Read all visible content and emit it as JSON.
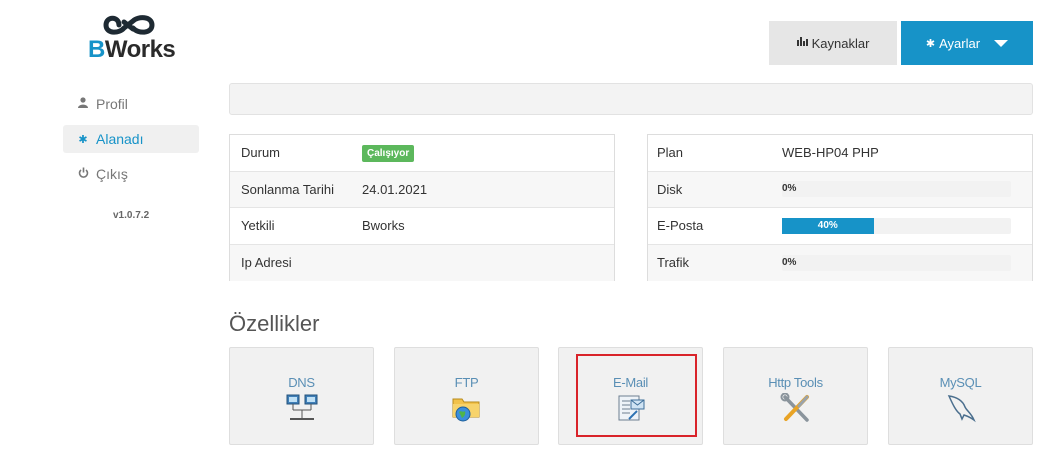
{
  "brand": {
    "name_prefix": "B",
    "name_rest": "Works",
    "accent": "#1793c8",
    "logo_icon": "infinity-logo"
  },
  "sidebar": {
    "items": [
      {
        "label": "Profil",
        "icon": "user-icon",
        "active": false
      },
      {
        "label": "Alanadı",
        "icon": "gear-icon",
        "active": true
      },
      {
        "label": "Çıkış",
        "icon": "power-icon",
        "active": false
      }
    ],
    "version": "v1.0.7.2"
  },
  "header": {
    "resources_label": "Kaynaklar",
    "resources_icon": "bar-chart-icon",
    "settings_label": "Ayarlar",
    "settings_icon": "gear-icon"
  },
  "info_left": [
    {
      "key": "Durum",
      "value": "Çalışıyor",
      "status_color": "#5cb85c"
    },
    {
      "key": "Sonlanma Tarihi",
      "value": "24.01.2021"
    },
    {
      "key": "Yetkili",
      "value": "Bworks"
    },
    {
      "key": "Ip Adresi",
      "value": ""
    }
  ],
  "info_right": {
    "plan": {
      "key": "Plan",
      "value": "WEB-HP04 PHP"
    },
    "disk": {
      "key": "Disk",
      "label": "0%",
      "percent": 0
    },
    "email": {
      "key": "E-Posta",
      "label": "40%",
      "percent": 40
    },
    "traffic": {
      "key": "Trafik",
      "label": "0%",
      "percent": 0
    }
  },
  "features": {
    "title": "Özellikler",
    "items": [
      {
        "label": "DNS",
        "icon": "network-icon"
      },
      {
        "label": "FTP",
        "icon": "folder-globe-icon"
      },
      {
        "label": "E-Mail",
        "icon": "mail-document-icon",
        "highlighted": true
      },
      {
        "label": "Http Tools",
        "icon": "tools-icon"
      },
      {
        "label": "MySQL",
        "icon": "dolphin-icon"
      }
    ]
  }
}
